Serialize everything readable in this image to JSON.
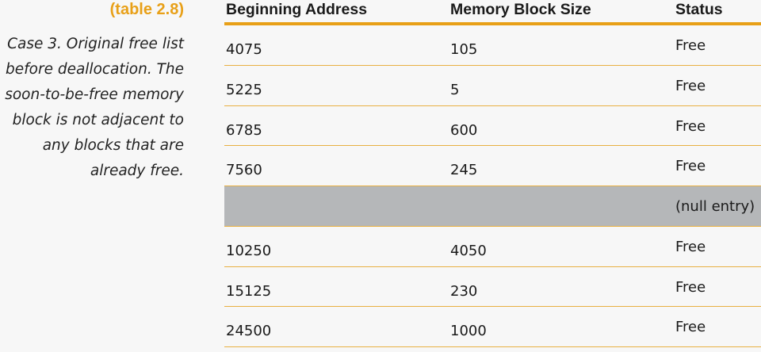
{
  "sidebar": {
    "table_label": "(table 2.8)",
    "caption_lines": [
      "Case 3. Original free list",
      "before deallocation. The",
      "soon-to-be-free memory",
      "block is not adjacent to",
      "any blocks that are",
      "already free."
    ]
  },
  "table": {
    "headers": [
      "Beginning Address",
      "Memory Block Size",
      "Status"
    ],
    "rows": [
      {
        "address": "4075",
        "size": "105",
        "status": "Free",
        "highlight": false
      },
      {
        "address": "5225",
        "size": "5",
        "status": "Free",
        "highlight": false
      },
      {
        "address": "6785",
        "size": "600",
        "status": "Free",
        "highlight": false
      },
      {
        "address": "7560",
        "size": "245",
        "status": "Free",
        "highlight": false
      },
      {
        "address": "",
        "size": "",
        "status": "(null entry)",
        "highlight": true
      },
      {
        "address": "10250",
        "size": "4050",
        "status": "Free",
        "highlight": false
      },
      {
        "address": "15125",
        "size": "230",
        "status": "Free",
        "highlight": false
      },
      {
        "address": "24500",
        "size": "1000",
        "status": "Free",
        "highlight": false
      }
    ]
  },
  "colors": {
    "accent": "#e8a018",
    "highlight_row": "#b5b7b9",
    "background": "#f7f7f7"
  }
}
